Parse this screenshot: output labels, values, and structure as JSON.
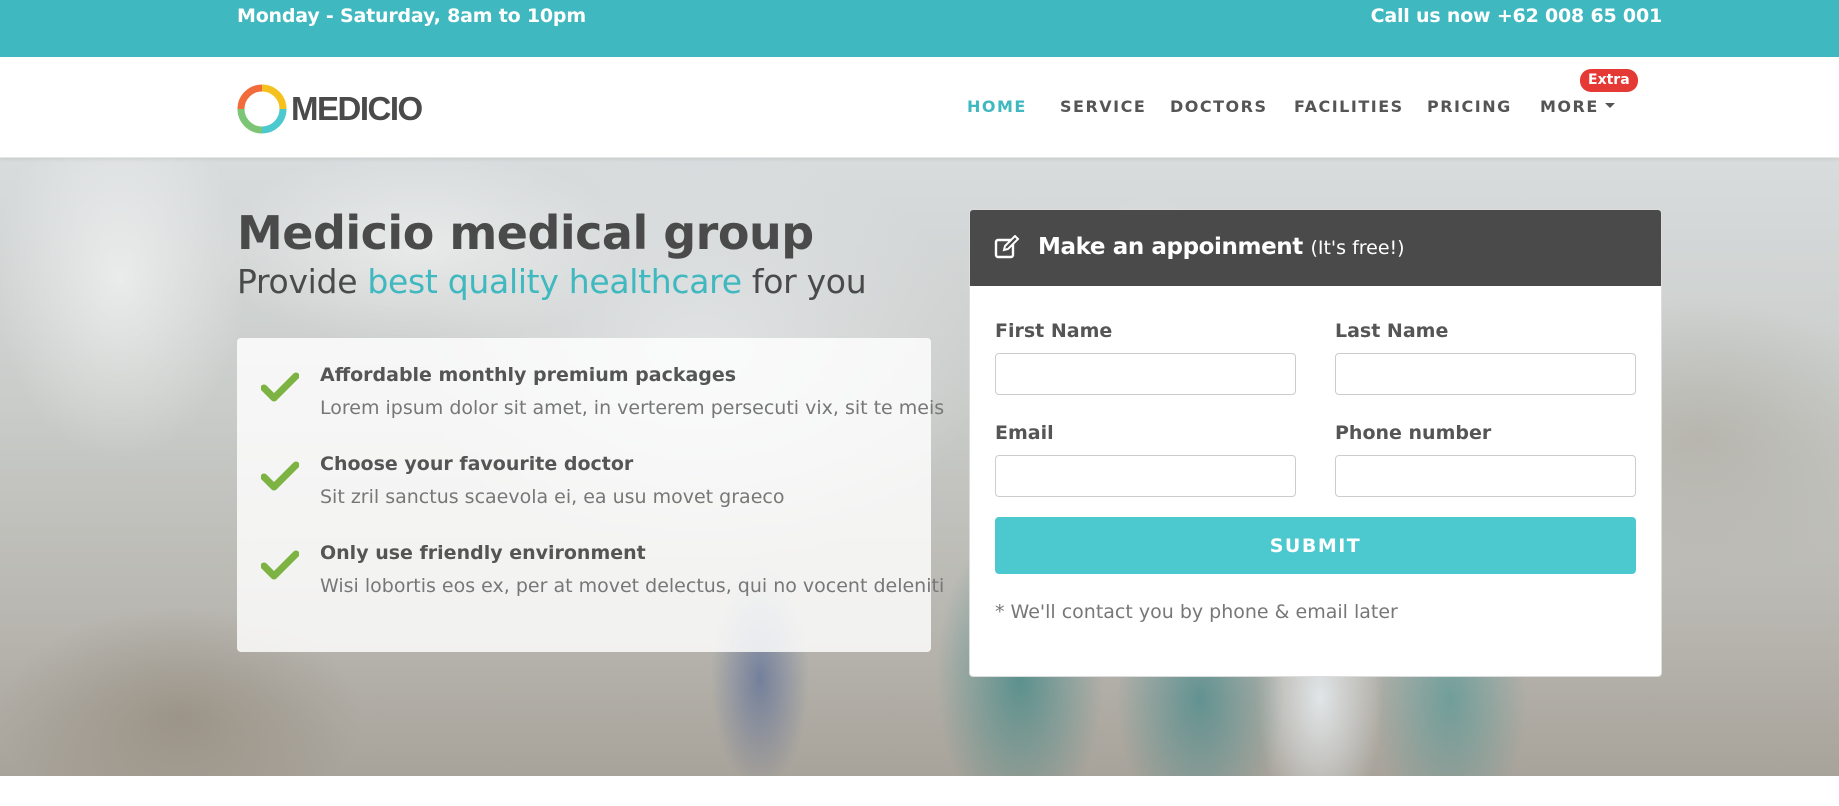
{
  "topbar": {
    "hours": "Monday - Saturday, 8am to 10pm",
    "phone": "Call us now +62 008 65 001"
  },
  "brand": {
    "name": "MEDICIO",
    "logo_icon": "ring-logo-icon"
  },
  "nav": {
    "items": [
      {
        "label": "HOME",
        "active": true
      },
      {
        "label": "SERVICE",
        "active": false
      },
      {
        "label": "DOCTORS",
        "active": false
      },
      {
        "label": "FACILITIES",
        "active": false
      },
      {
        "label": "PRICING",
        "active": false
      },
      {
        "label": "MORE",
        "active": false
      }
    ],
    "badge": "Extra"
  },
  "hero": {
    "title": "Medicio medical group",
    "sub_before": "Provide ",
    "sub_highlight": "best quality healthcare",
    "sub_after": " for you",
    "features": [
      {
        "title": "Affordable monthly premium packages",
        "desc": "Lorem ipsum dolor sit amet, in verterem persecuti vix, sit te meis"
      },
      {
        "title": "Choose your favourite doctor",
        "desc": "Sit zril sanctus scaevola ei, ea usu movet graeco"
      },
      {
        "title": "Only use friendly environment",
        "desc": "Wisi lobortis eos ex, per at movet delectus, qui no vocent deleniti"
      }
    ]
  },
  "form": {
    "title": "Make an appoinment",
    "title_note": "(It's free!)",
    "first_name_label": "First Name",
    "last_name_label": "Last Name",
    "email_label": "Email",
    "phone_label": "Phone number",
    "first_name_value": "",
    "last_name_value": "",
    "email_value": "",
    "phone_value": "",
    "submit_label": "SUBMIT",
    "note": "* We'll contact you by phone & email later"
  },
  "colors": {
    "accent": "#3fb8bf",
    "submit": "#4cc8cf",
    "panel_header": "#4a4a4a",
    "badge": "#e53935",
    "check": "#7cb342"
  }
}
